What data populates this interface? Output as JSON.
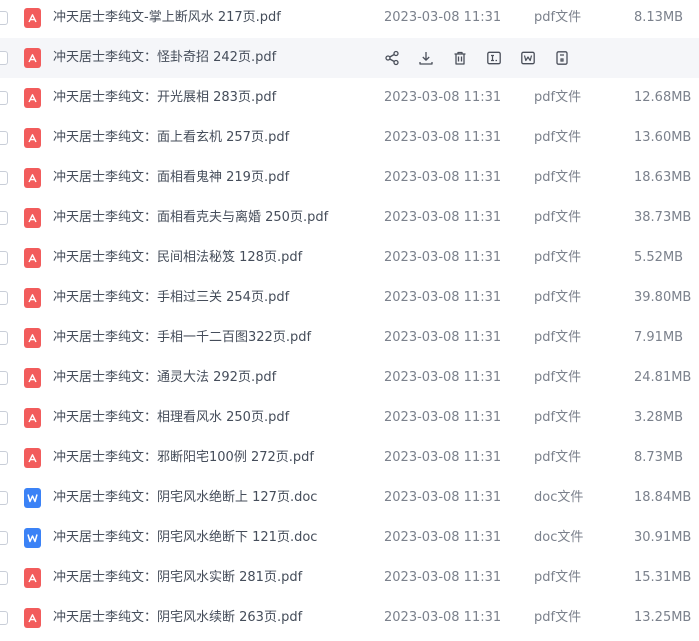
{
  "files": [
    {
      "name": "冲天居士李纯文-掌上断风水 217页.pdf",
      "date": "2023-03-08 11:31",
      "type": "pdf文件",
      "size": "8.13MB",
      "kind": "pdf"
    },
    {
      "name": "冲天居士李纯文：怪卦奇招 242页.pdf",
      "date": "2023-03-08 11:31",
      "type": "pdf文件",
      "size": "",
      "kind": "pdf",
      "hover": true
    },
    {
      "name": "冲天居士李纯文：开光展相 283页.pdf",
      "date": "2023-03-08 11:31",
      "type": "pdf文件",
      "size": "12.68MB",
      "kind": "pdf"
    },
    {
      "name": "冲天居士李纯文：面上看玄机 257页.pdf",
      "date": "2023-03-08 11:31",
      "type": "pdf文件",
      "size": "13.60MB",
      "kind": "pdf"
    },
    {
      "name": "冲天居士李纯文：面相看鬼神 219页.pdf",
      "date": "2023-03-08 11:31",
      "type": "pdf文件",
      "size": "18.63MB",
      "kind": "pdf"
    },
    {
      "name": "冲天居士李纯文：面相看克夫与离婚 250页.pdf",
      "date": "2023-03-08 11:31",
      "type": "pdf文件",
      "size": "38.73MB",
      "kind": "pdf"
    },
    {
      "name": "冲天居士李纯文：民间相法秘笈 128页.pdf",
      "date": "2023-03-08 11:31",
      "type": "pdf文件",
      "size": "5.52MB",
      "kind": "pdf"
    },
    {
      "name": "冲天居士李纯文：手相过三关 254页.pdf",
      "date": "2023-03-08 11:31",
      "type": "pdf文件",
      "size": "39.80MB",
      "kind": "pdf"
    },
    {
      "name": "冲天居士李纯文：手相一千二百图322页.pdf",
      "date": "2023-03-08 11:31",
      "type": "pdf文件",
      "size": "7.91MB",
      "kind": "pdf"
    },
    {
      "name": "冲天居士李纯文：通灵大法 292页.pdf",
      "date": "2023-03-08 11:31",
      "type": "pdf文件",
      "size": "24.81MB",
      "kind": "pdf"
    },
    {
      "name": "冲天居士李纯文：相理看风水 250页.pdf",
      "date": "2023-03-08 11:31",
      "type": "pdf文件",
      "size": "3.28MB",
      "kind": "pdf"
    },
    {
      "name": "冲天居士李纯文：邪断阳宅100例 272页.pdf",
      "date": "2023-03-08 11:31",
      "type": "pdf文件",
      "size": "8.73MB",
      "kind": "pdf"
    },
    {
      "name": "冲天居士李纯文：阴宅风水绝断上 127页.doc",
      "date": "2023-03-08 11:31",
      "type": "doc文件",
      "size": "18.84MB",
      "kind": "doc"
    },
    {
      "name": "冲天居士李纯文：阴宅风水绝断下 121页.doc",
      "date": "2023-03-08 11:31",
      "type": "doc文件",
      "size": "30.91MB",
      "kind": "doc"
    },
    {
      "name": "冲天居士李纯文：阴宅风水实断 281页.pdf",
      "date": "2023-03-08 11:31",
      "type": "pdf文件",
      "size": "15.31MB",
      "kind": "pdf"
    },
    {
      "name": "冲天居士李纯文：阴宅风水续断 263页.pdf",
      "date": "2023-03-08 11:31",
      "type": "pdf文件",
      "size": "13.25MB",
      "kind": "pdf"
    }
  ],
  "hover_actions": [
    {
      "icon": "share-icon"
    },
    {
      "icon": "download-icon"
    },
    {
      "icon": "delete-icon"
    },
    {
      "icon": "rename-icon"
    },
    {
      "icon": "word-icon"
    },
    {
      "icon": "more-icon"
    }
  ],
  "colors": {
    "pdf": "#f25c5c",
    "doc": "#3b82f6",
    "hover_bg": "#f5f6f9"
  }
}
